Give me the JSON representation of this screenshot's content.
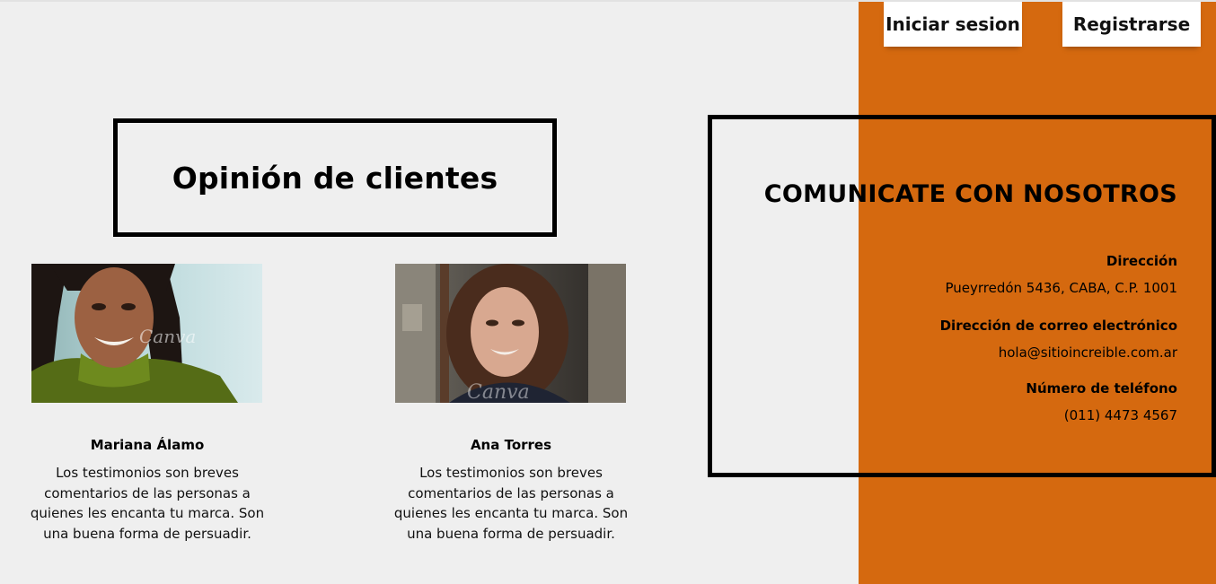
{
  "header": {
    "login_label": "Iniciar sesion",
    "register_label": "Registrarse"
  },
  "testimonials_section": {
    "title": "Opinión de clientes",
    "items": [
      {
        "name": "Mariana Álamo",
        "text": "Los testimonios son breves comentarios de las personas a quienes les encanta tu marca. Son una buena forma de persuadir.",
        "photo_icon": "woman-portrait-photo"
      },
      {
        "name": "Ana Torres",
        "text": "Los testimonios son breves comentarios de las personas a quienes les encanta tu marca. Son una buena forma de persuadir.",
        "photo_icon": "woman-portrait-photo"
      }
    ],
    "watermark": "Canva"
  },
  "contact": {
    "title": "COMUNICATE CON NOSOTROS",
    "address_label": "Dirección",
    "address_value": "Pueyrredón 5436, CABA, C.P. 1001",
    "email_label": "Dirección de correo electrónico",
    "email_value": "hola@sitioincreible.com.ar",
    "phone_label": "Número de teléfono",
    "phone_value": "(011) 4473 4567"
  },
  "colors": {
    "background": "#efefef",
    "accent_orange": "#d5690f",
    "border": "#000000",
    "button_bg": "#ffffff"
  }
}
